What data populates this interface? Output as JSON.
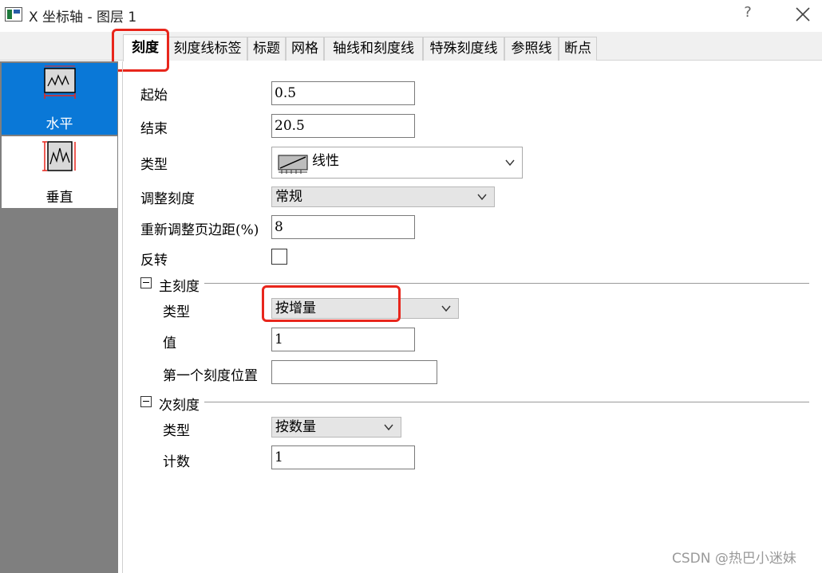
{
  "window": {
    "title": "X 坐标轴 - 图层 1",
    "help_label": "?"
  },
  "tabs": [
    {
      "label": "刻度",
      "active": true
    },
    {
      "label": "刻度线标签"
    },
    {
      "label": "标题"
    },
    {
      "label": "网格"
    },
    {
      "label": "轴线和刻度线"
    },
    {
      "label": "特殊刻度线"
    },
    {
      "label": "参照线"
    },
    {
      "label": "断点"
    }
  ],
  "sidebar": {
    "items": [
      {
        "label": "水平",
        "icon": "horizontal-axis-icon",
        "selected": true
      },
      {
        "label": "垂直",
        "icon": "vertical-axis-icon"
      }
    ]
  },
  "form": {
    "start": {
      "label": "起始",
      "value": "0.5"
    },
    "end": {
      "label": "结束",
      "value": "20.5"
    },
    "type": {
      "label": "类型",
      "value": "线性",
      "icon": "linear-scale-icon"
    },
    "rescale": {
      "label": "调整刻度",
      "value": "常规"
    },
    "rescale_margin": {
      "label": "重新调整页边距(%)",
      "value": "8"
    },
    "reverse": {
      "label": "反转",
      "checked": false
    }
  },
  "major_ticks": {
    "header": "主刻度",
    "type": {
      "label": "类型",
      "value": "按增量"
    },
    "value": {
      "label": "值",
      "value": "1"
    },
    "first_tick": {
      "label": "第一个刻度位置",
      "value": ""
    }
  },
  "minor_ticks": {
    "header": "次刻度",
    "type": {
      "label": "类型",
      "value": "按数量"
    },
    "count": {
      "label": "计数",
      "value": "1"
    }
  },
  "watermark": "CSDN @热巴小迷妹",
  "colors": {
    "accent_selected": "#0a78d7",
    "highlight": "#e8261c",
    "nav_bg": "#7f7f7f"
  }
}
